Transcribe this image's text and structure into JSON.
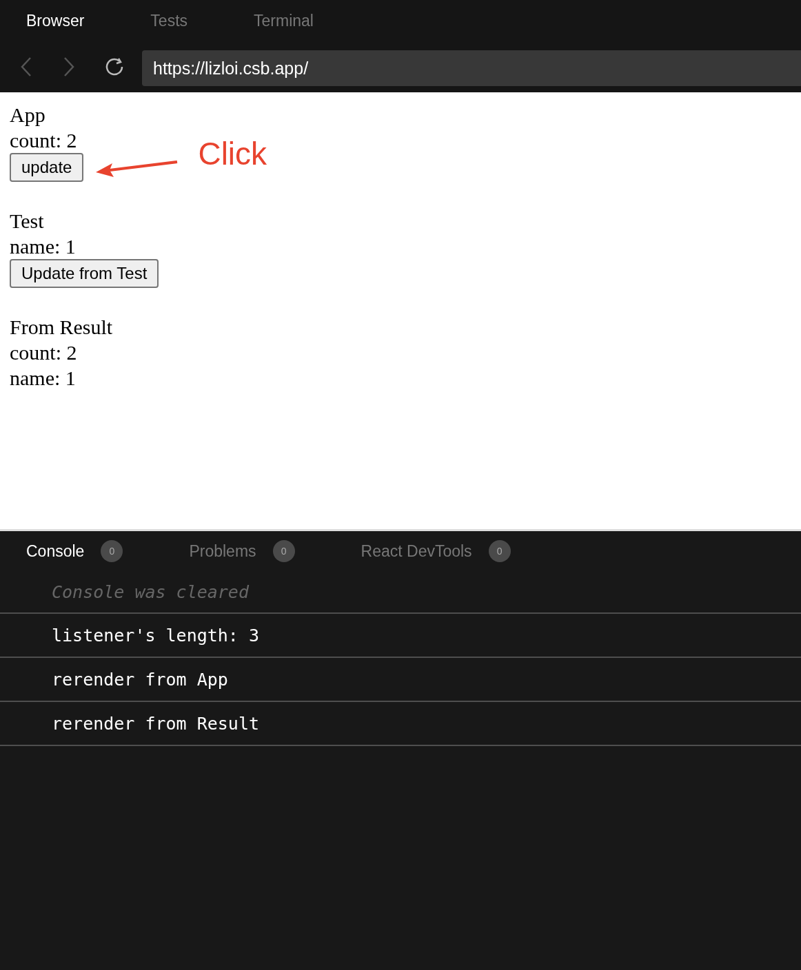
{
  "tabs": [
    {
      "label": "Browser",
      "selected": true
    },
    {
      "label": "Tests",
      "selected": false
    },
    {
      "label": "Terminal",
      "selected": false
    }
  ],
  "address_bar": {
    "value": "https://lizloi.csb.app/"
  },
  "page": {
    "sections": [
      {
        "title": "App",
        "lines": [
          "count: 2"
        ],
        "button": "update",
        "annotation": "Click"
      },
      {
        "title": "Test",
        "lines": [
          "name: 1"
        ],
        "button": "Update from Test"
      },
      {
        "title": "From Result",
        "lines": [
          "count: 2",
          "name: 1"
        ]
      }
    ]
  },
  "console": {
    "tabs": [
      {
        "label": "Console",
        "count": "0",
        "selected": true
      },
      {
        "label": "Problems",
        "count": "0",
        "selected": false
      },
      {
        "label": "React DevTools",
        "count": "0",
        "selected": false
      }
    ],
    "messages": [
      {
        "kind": "info",
        "text": "Console was cleared"
      },
      {
        "kind": "log",
        "text": "listener's length: 3"
      },
      {
        "kind": "log",
        "text": "rerender from App"
      },
      {
        "kind": "log",
        "text": "rerender from Result"
      }
    ]
  }
}
